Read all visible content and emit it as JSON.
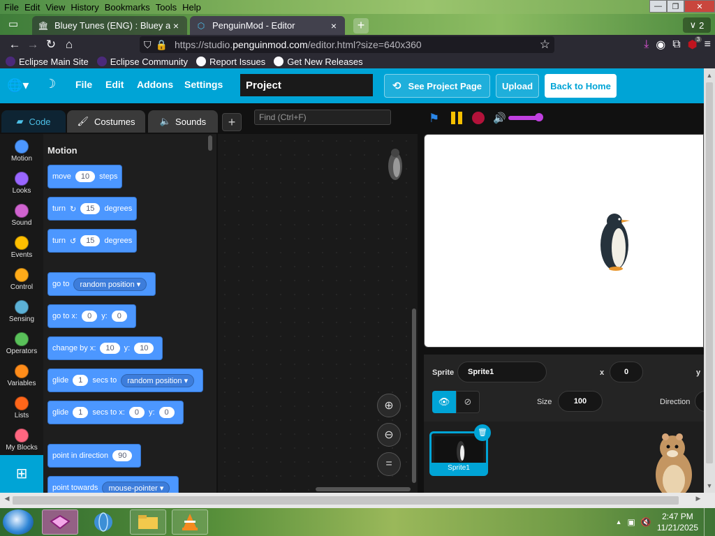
{
  "menubar": {
    "items": [
      "File",
      "Edit",
      "View",
      "History",
      "Bookmarks",
      "Tools",
      "Help"
    ],
    "window_controls": [
      "—",
      "❐",
      "✕"
    ]
  },
  "tabs": [
    {
      "title": "Bluey Tunes (ENG) : Bluey and A",
      "active": false
    },
    {
      "title": "PenguinMod - Editor",
      "active": true
    }
  ],
  "tab_count": "2",
  "url": {
    "prefix": "https://studio.",
    "domain": "penguinmod.com",
    "path": "/editor.html?size=640x360"
  },
  "extension_badge": "3",
  "bookmarks": [
    "Eclipse Main Site",
    "Eclipse Community",
    "Report Issues",
    "Get New Releases"
  ],
  "editor": {
    "menu": [
      "File",
      "Edit",
      "Addons",
      "Settings"
    ],
    "project_title": "Project",
    "see_project_page": "See Project Page",
    "upload": "Upload",
    "back_to_home": "Back to Home",
    "tabs": {
      "code": "Code",
      "costumes": "Costumes",
      "sounds": "Sounds"
    },
    "find_placeholder": "Find (Ctrl+F)",
    "categories": [
      {
        "name": "Motion",
        "color": "#4c97ff"
      },
      {
        "name": "Looks",
        "color": "#9966ff"
      },
      {
        "name": "Sound",
        "color": "#cf63cf"
      },
      {
        "name": "Events",
        "color": "#ffbf00"
      },
      {
        "name": "Control",
        "color": "#ffab19"
      },
      {
        "name": "Sensing",
        "color": "#5cb1d6"
      },
      {
        "name": "Operators",
        "color": "#59c059"
      },
      {
        "name": "Variables",
        "color": "#ff8c1a"
      },
      {
        "name": "Lists",
        "color": "#ff661a"
      },
      {
        "name": "My Blocks",
        "color": "#ff6680"
      }
    ],
    "palette_title": "Motion",
    "blocks": {
      "move": {
        "pre": "move",
        "v1": "10",
        "post": "steps"
      },
      "turn_cw": {
        "pre": "turn",
        "v1": "15",
        "post": "degrees"
      },
      "turn_ccw": {
        "pre": "turn",
        "v1": "15",
        "post": "degrees"
      },
      "goto": {
        "pre": "go to",
        "dd": "random position"
      },
      "goto_xy": {
        "pre": "go to x:",
        "x": "0",
        "mid": "y:",
        "y": "0"
      },
      "change_by": {
        "pre": "change by x:",
        "x": "10",
        "mid": "y:",
        "y": "10"
      },
      "glide_to": {
        "pre": "glide",
        "v1": "1",
        "mid": "secs to",
        "dd": "random position"
      },
      "glide_xy": {
        "pre": "glide",
        "v1": "1",
        "mid": "secs to x:",
        "x": "0",
        "mid2": "y:",
        "y": "0"
      },
      "point_dir": {
        "pre": "point in direction",
        "v1": "90"
      },
      "point_towards": {
        "pre": "point towards",
        "dd": "mouse-pointer"
      }
    },
    "sprite_info": {
      "sprite_label": "Sprite",
      "sprite_name": "Sprite1",
      "x_label": "x",
      "x": "0",
      "y_label": "y",
      "size_label": "Size",
      "size": "100",
      "direction_label": "Direction"
    },
    "sprite_tile_name": "Sprite1"
  },
  "clock": {
    "time": "2:47 PM",
    "date": "11/21/2025"
  }
}
